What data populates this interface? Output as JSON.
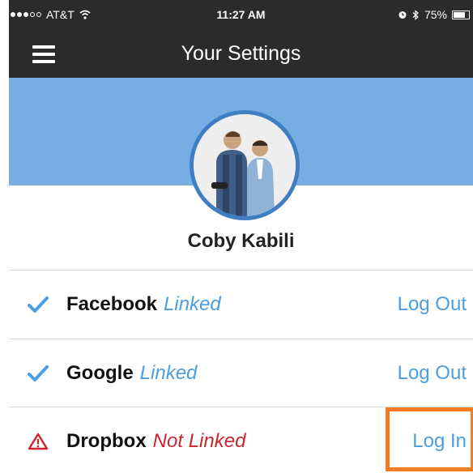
{
  "status_bar": {
    "carrier": "AT&T",
    "time": "11:27 AM",
    "battery": "75%",
    "battery_level": 0.75,
    "signal_icon": "signal-dots-icon",
    "wifi_icon": "wifi-icon",
    "alarm_icon": "alarm-icon",
    "bluetooth_icon": "bluetooth-icon"
  },
  "nav": {
    "title": "Your Settings",
    "menu_icon": "hamburger-menu-icon"
  },
  "profile": {
    "name": "Coby Kabili",
    "avatar": "profile-photo"
  },
  "accounts": [
    {
      "service": "Facebook",
      "state": "Linked",
      "action": "Log Out",
      "icon": "checkmark-icon"
    },
    {
      "service": "Google",
      "state": "Linked",
      "action": "Log Out",
      "icon": "checkmark-icon"
    },
    {
      "service": "Dropbox",
      "state": "Not Linked",
      "action": "Log In",
      "icon": "warning-triangle-icon"
    }
  ],
  "colors": {
    "dark_bar": "#2b2b2b",
    "banner": "#76ade3",
    "avatar_ring": "#3f7ec2",
    "linked": "#4b9ee0",
    "not_linked": "#c9262f",
    "highlight": "#f47c22"
  }
}
